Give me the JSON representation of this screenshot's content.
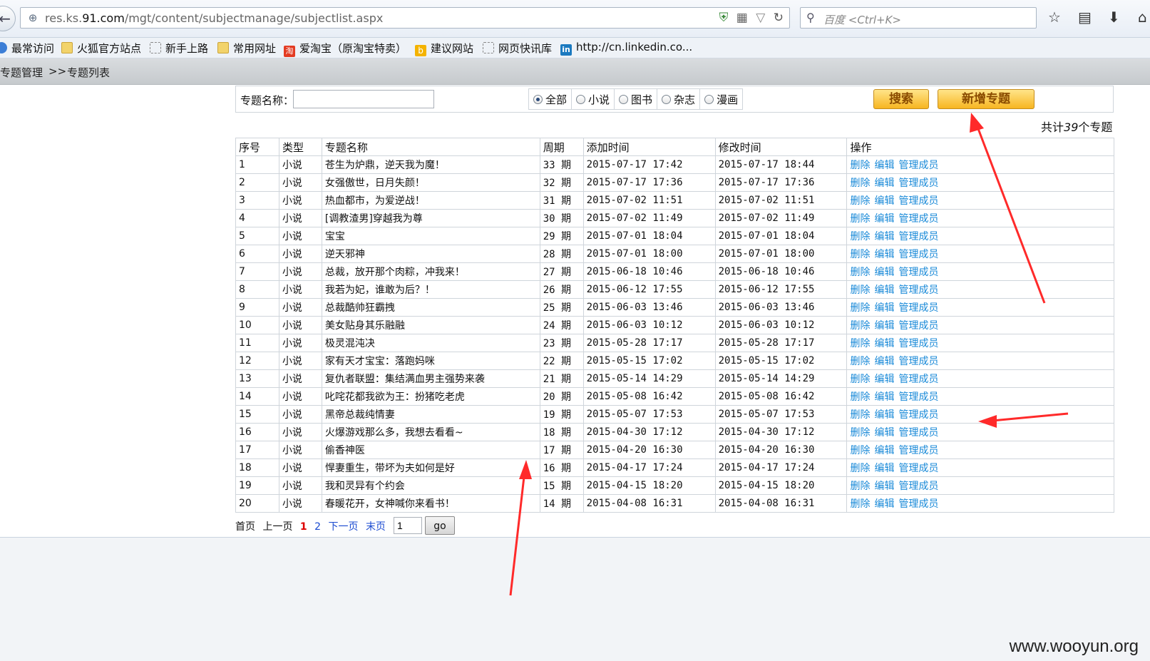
{
  "browser": {
    "url_domain_prefix": "res.ks.",
    "url_domain_bold": "91.com",
    "url_path": "/mgt/content/subjectmanage/subjectlist.aspx",
    "search_placeholder": "百度 <Ctrl+K>",
    "icons": [
      "back-arrow-icon",
      "globe-icon",
      "shield-icon",
      "qr-icon",
      "dropdown-icon",
      "refresh-icon",
      "search-icon",
      "star-icon",
      "reading-list-icon",
      "download-icon",
      "home-icon"
    ]
  },
  "bookmarks": [
    {
      "label": "最常访问",
      "icon": "globe"
    },
    {
      "label": "火狐官方站点",
      "icon": "folder"
    },
    {
      "label": "新手上路",
      "icon": "page"
    },
    {
      "label": "常用网址",
      "icon": "folder"
    },
    {
      "label": "爱淘宝（原淘宝特卖）",
      "icon": "taobao"
    },
    {
      "label": "建议网站",
      "icon": "bing"
    },
    {
      "label": "网页快讯库",
      "icon": "page"
    },
    {
      "label": "http://cn.linkedin.co...",
      "icon": "in"
    }
  ],
  "breadcrumb": {
    "root": "专题管理",
    "sep": ">>",
    "current": "专题列表"
  },
  "search": {
    "label": "专题名称：",
    "value": "",
    "types": [
      {
        "label": "全部",
        "checked": true
      },
      {
        "label": "小说",
        "checked": false
      },
      {
        "label": "图书",
        "checked": false
      },
      {
        "label": "杂志",
        "checked": false
      },
      {
        "label": "漫画",
        "checked": false
      }
    ],
    "search_button": "搜索",
    "add_button": "新增专题"
  },
  "summary": {
    "prefix": "共计",
    "count": "39",
    "suffix": "个专题"
  },
  "table": {
    "headers": [
      "序号",
      "类型",
      "专题名称",
      "周期",
      "添加时间",
      "修改时间",
      "操作"
    ],
    "actions": [
      "删除",
      "编辑",
      "管理成员"
    ],
    "rows": [
      [
        "1",
        "小说",
        "苍生为炉鼎，逆天我为魔！",
        "33 期",
        "2015-07-17 17:42",
        "2015-07-17 18:44"
      ],
      [
        "2",
        "小说",
        "女强傲世，日月失颜！",
        "32 期",
        "2015-07-17 17:36",
        "2015-07-17 17:36"
      ],
      [
        "3",
        "小说",
        "热血都市，为爱逆战！",
        "31 期",
        "2015-07-02 11:51",
        "2015-07-02 11:51"
      ],
      [
        "4",
        "小说",
        "[调教渣男]穿越我为尊",
        "30 期",
        "2015-07-02 11:49",
        "2015-07-02 11:49"
      ],
      [
        "5",
        "小说",
        "宝宝",
        "29 期",
        "2015-07-01 18:04",
        "2015-07-01 18:04"
      ],
      [
        "6",
        "小说",
        "逆天邪神",
        "28 期",
        "2015-07-01 18:00",
        "2015-07-01 18:00"
      ],
      [
        "7",
        "小说",
        "总裁，放开那个肉粽，冲我来！",
        "27 期",
        "2015-06-18 10:46",
        "2015-06-18 10:46"
      ],
      [
        "8",
        "小说",
        "我若为妃，谁敢为后？！",
        "26 期",
        "2015-06-12 17:55",
        "2015-06-12 17:55"
      ],
      [
        "9",
        "小说",
        "总裁酷帅狂霸拽",
        "25 期",
        "2015-06-03 13:46",
        "2015-06-03 13:46"
      ],
      [
        "10",
        "小说",
        "美女贴身其乐融融",
        "24 期",
        "2015-06-03 10:12",
        "2015-06-03 10:12"
      ],
      [
        "11",
        "小说",
        "极灵混沌决",
        "23 期",
        "2015-05-28 17:17",
        "2015-05-28 17:17"
      ],
      [
        "12",
        "小说",
        "家有天才宝宝：落跑妈咪",
        "22 期",
        "2015-05-15 17:02",
        "2015-05-15 17:02"
      ],
      [
        "13",
        "小说",
        "复仇者联盟：集结满血男主强势来袭",
        "21 期",
        "2015-05-14 14:29",
        "2015-05-14 14:29"
      ],
      [
        "14",
        "小说",
        "叱咤花都我欲为王：扮猪吃老虎",
        "20 期",
        "2015-05-08 16:42",
        "2015-05-08 16:42"
      ],
      [
        "15",
        "小说",
        "黑帝总裁纯情妻",
        "19 期",
        "2015-05-07 17:53",
        "2015-05-07 17:53"
      ],
      [
        "16",
        "小说",
        "火爆游戏那么多，我想去看看~",
        "18 期",
        "2015-04-30 17:12",
        "2015-04-30 17:12"
      ],
      [
        "17",
        "小说",
        "偷香神医",
        "17 期",
        "2015-04-20 16:30",
        "2015-04-20 16:30"
      ],
      [
        "18",
        "小说",
        "悍妻重生，带坏为夫如何是好",
        "16 期",
        "2015-04-17 17:24",
        "2015-04-17 17:24"
      ],
      [
        "19",
        "小说",
        "我和灵异有个约会",
        "15 期",
        "2015-04-15 18:20",
        "2015-04-15 18:20"
      ],
      [
        "20",
        "小说",
        "春暖花开，女神喊你来看书！",
        "14 期",
        "2015-04-08 16:31",
        "2015-04-08 16:31"
      ]
    ]
  },
  "pager": {
    "first": "首页",
    "prev": "上一页",
    "page1": "1",
    "page2": "2",
    "next": "下一页",
    "last": "末页",
    "input_value": "1",
    "go": "go"
  },
  "watermark": "www.wooyun.org",
  "colors": {
    "link": "#1a8ad8",
    "annotation": "#ff2a2a",
    "button": "#f7b521"
  }
}
